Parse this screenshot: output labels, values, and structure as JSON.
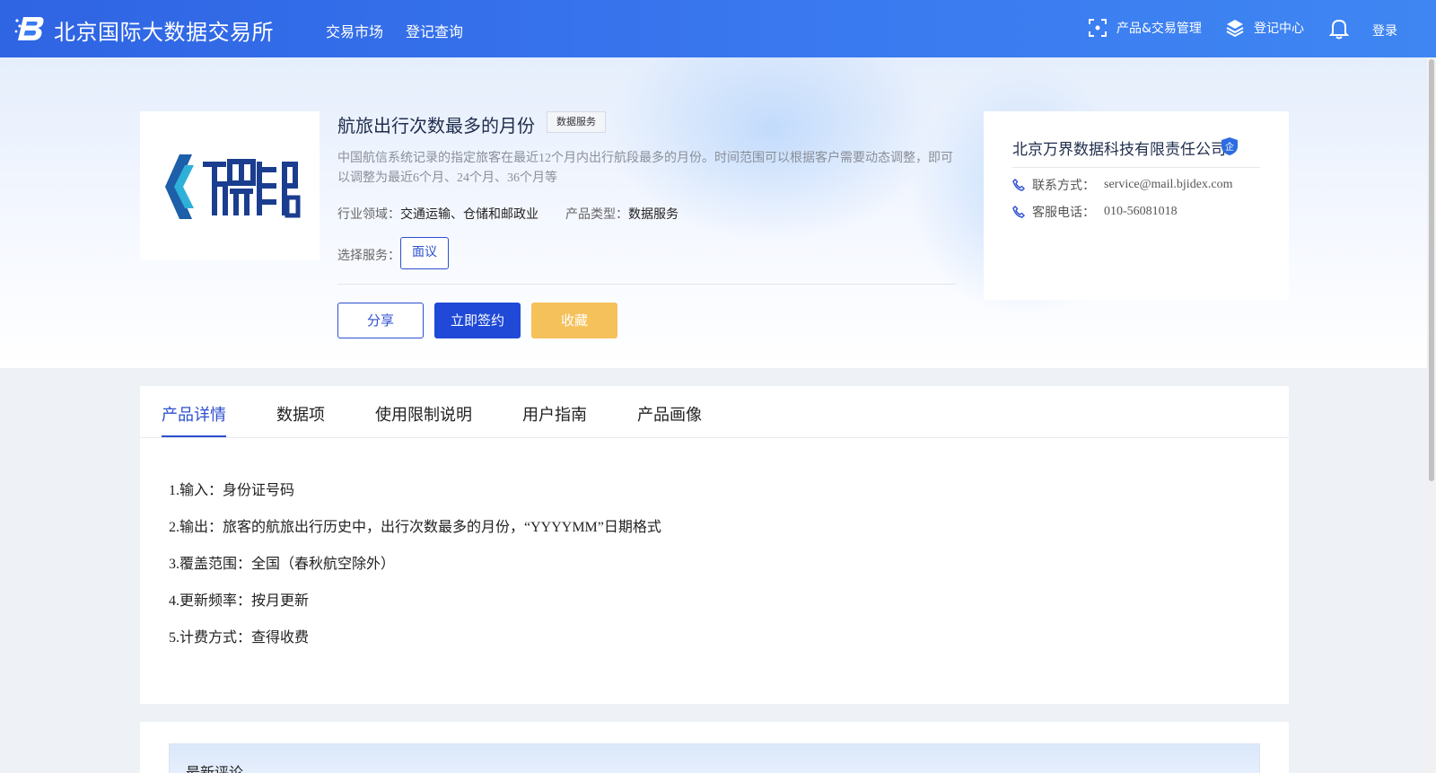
{
  "header": {
    "brand": "北京国际大数据交易所",
    "nav": [
      "交易市场",
      "登记查询"
    ],
    "product_mgmt": "产品&交易管理",
    "registry_center": "登记中心",
    "login": "登录"
  },
  "product": {
    "title": "航旅出行次数最多的月份",
    "tag": "数据服务",
    "description": "中国航信系统记录的指定旅客在最近12个月内出行航段最多的月份。时间范围可以根据客户需要动态调整，即可以调整为最近6个月、24个月、36个月等",
    "industry_label": "行业领域：",
    "industry_value": "交通运输、仓储和邮政业",
    "type_label": "产品类型：",
    "type_value": "数据服务",
    "service_label": "选择服务：",
    "service_option": "面议",
    "actions": {
      "share": "分享",
      "sign": "立即签约",
      "favorite": "收藏"
    }
  },
  "company": {
    "name": "北京万界数据科技有限责任公司",
    "badge": "企",
    "contact_label": "联系方式：",
    "contact_value": "service@mail.bjidex.com",
    "phone_label": "客服电话：",
    "phone_value": "010-56081018"
  },
  "tabs": [
    "产品详情",
    "数据项",
    "使用限制说明",
    "用户指南",
    "产品画像"
  ],
  "details": [
    "1.输入：身份证号码",
    "2.输出：旅客的航旅出行历史中，出行次数最多的月份，“YYYYMM”日期格式",
    "3.覆盖范围：全国（春秋航空除外）",
    "4.更新频率：按月更新",
    "5.计费方式：查得收费"
  ],
  "comments": {
    "title": "最新评论"
  },
  "colors": {
    "primary": "#2c4fd0",
    "header": "#3a7af0",
    "favorite": "#f5c15a"
  }
}
